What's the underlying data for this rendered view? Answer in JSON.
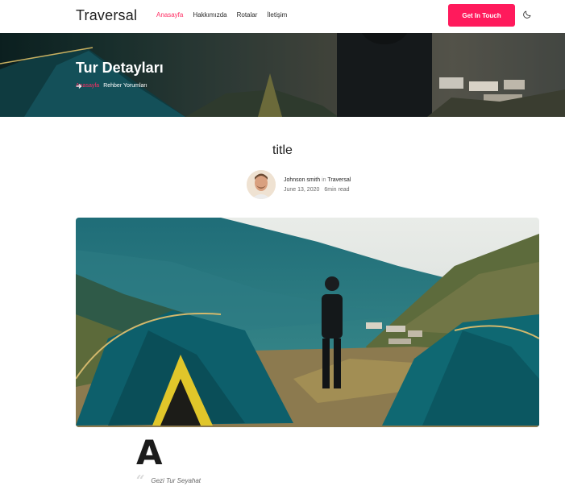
{
  "header": {
    "brand": "Traversal",
    "nav": [
      {
        "label": "Anasayfa",
        "active": true
      },
      {
        "label": "Hakkımızda",
        "active": false
      },
      {
        "label": "Rotalar",
        "active": false
      },
      {
        "label": "İletişim",
        "active": false
      }
    ],
    "cta_label": "Get In Touch",
    "theme_icon": "moon-icon"
  },
  "banner": {
    "title": "Tur Detayları",
    "breadcrumb": {
      "home": "Anasayfa",
      "separator_icon": "arrow-right-icon",
      "current": "Rehber Yorumları"
    }
  },
  "post": {
    "title": "title",
    "author": {
      "name": "Johnson smith",
      "in_word": "in",
      "publication": "Traversal",
      "date": "June 13, 2020",
      "read_time": "6min read"
    },
    "drop_cap": "A",
    "quote_text": "Gezi Tur Seyahat"
  },
  "colors": {
    "accent": "#ff1a5c",
    "text": "#1b1b1b"
  }
}
